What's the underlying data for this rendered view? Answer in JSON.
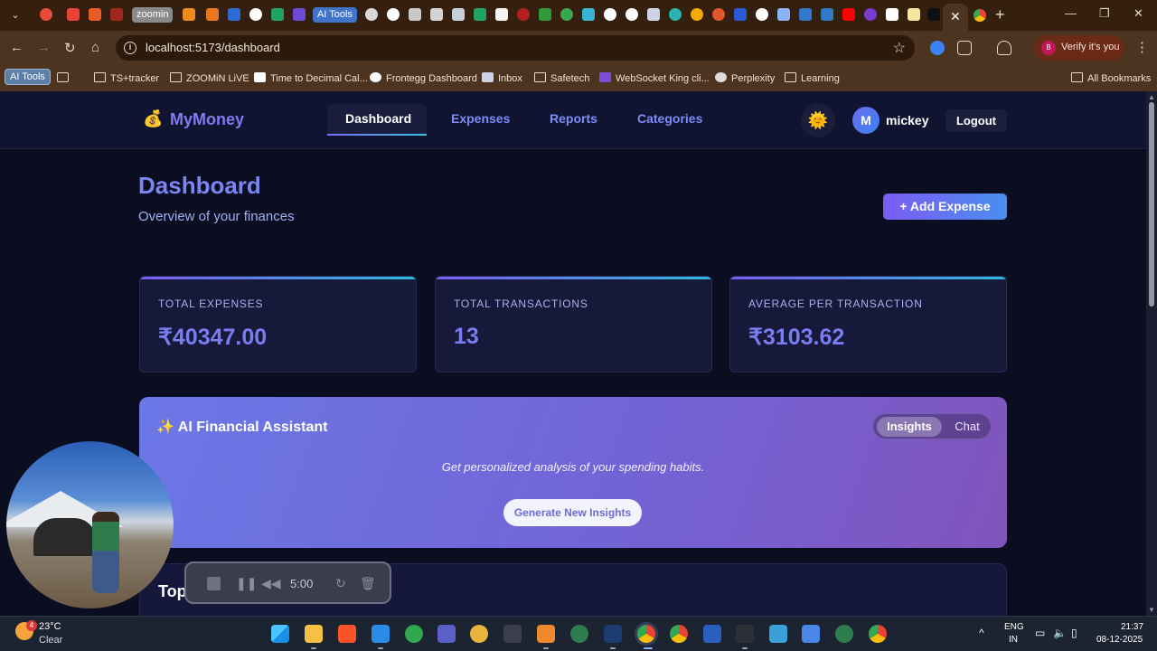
{
  "browser": {
    "tab_pills": [
      "zoomin",
      "AI Tools"
    ],
    "url": "localhost:5173/dashboard",
    "profile_initial": "B",
    "verify_label": "Verify it's you",
    "bookmarks": [
      "AI Tools",
      "TS+tracker",
      "ZOOMiN LiVE",
      "Time to Decimal Cal...",
      "Frontegg Dashboard",
      "Inbox",
      "Safetech",
      "WebSocket King cli...",
      "Perplexity",
      "Learning"
    ],
    "all_bookmarks": "All Bookmarks"
  },
  "header": {
    "brand_logo": "💰",
    "brand_name": "MyMoney",
    "nav": [
      "Dashboard",
      "Expenses",
      "Reports",
      "Categories"
    ],
    "active_nav": "Dashboard",
    "theme_icon": "🌞",
    "user_initial": "M",
    "username": "mickey",
    "logout_label": "Logout"
  },
  "page": {
    "title": "Dashboard",
    "subtitle": "Overview of your finances",
    "add_expense_label": "+ Add Expense"
  },
  "stats": [
    {
      "label": "TOTAL EXPENSES",
      "value": "₹40347.00"
    },
    {
      "label": "TOTAL TRANSACTIONS",
      "value": "13"
    },
    {
      "label": "AVERAGE PER TRANSACTION",
      "value": "₹3103.62"
    }
  ],
  "ai_panel": {
    "icon": "✨",
    "title": "AI Financial Assistant",
    "toggle": [
      "Insights",
      "Chat"
    ],
    "active_toggle": "Insights",
    "hint": "Get personalized analysis of your spending habits.",
    "generate_label": "Generate New Insights"
  },
  "next_section": {
    "title": "Top"
  },
  "recorder": {
    "time": "5:00"
  },
  "taskbar": {
    "weather_badge": "4",
    "temperature": "23°C",
    "condition": "Clear",
    "lang_1": "ENG",
    "lang_2": "IN",
    "time": "21:37",
    "date": "08-12-2025"
  }
}
